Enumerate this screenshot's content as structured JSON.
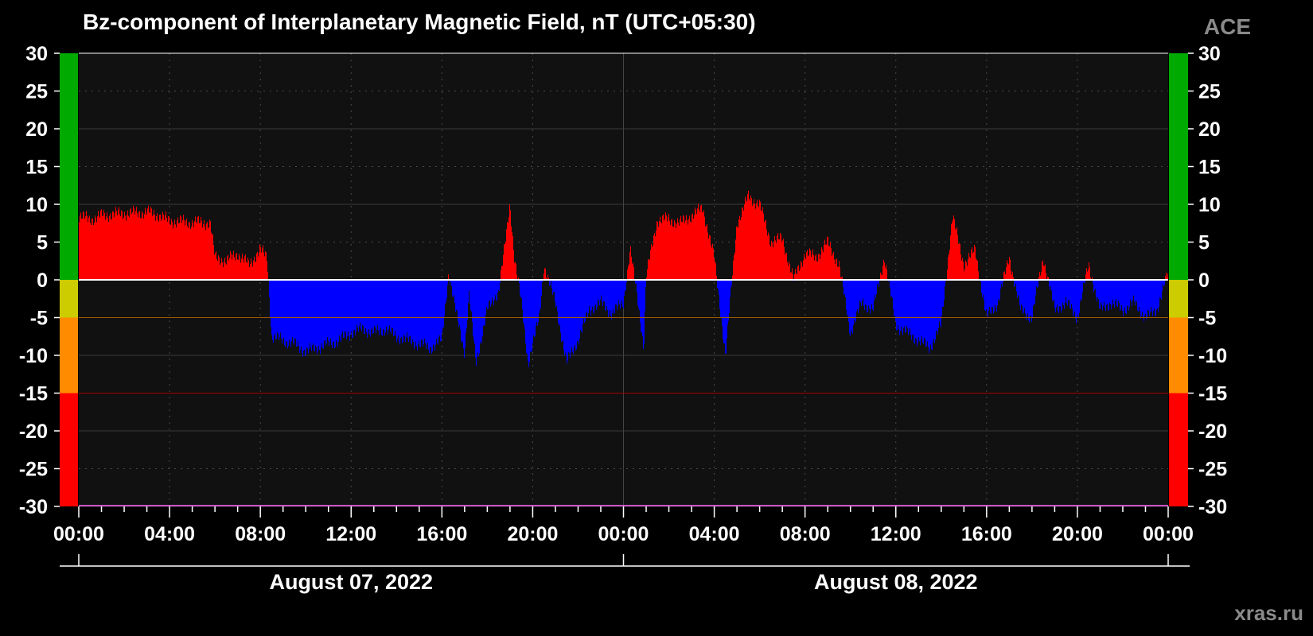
{
  "header": {
    "title": "Bz-component of Interplanetary Magnetic Field, nT (UTC+05:30)",
    "source": "ACE",
    "credit": "xras.ru"
  },
  "colors": {
    "background": "#000000",
    "plot_background": "#111111",
    "positive": "#ff0000",
    "negative": "#0000ff",
    "scale_green": "#00aa00",
    "scale_yellow": "#cccc00",
    "scale_orange": "#ff8c00",
    "scale_red": "#ff0000"
  },
  "chart_data": {
    "type": "bar",
    "title": "Bz-component of Interplanetary Magnetic Field, nT (UTC+05:30)",
    "ylim": [
      -30,
      30
    ],
    "yticks": [
      30,
      25,
      20,
      15,
      10,
      5,
      0,
      -5,
      -10,
      -15,
      -20,
      -25,
      -30
    ],
    "xlim_hours": [
      0,
      48
    ],
    "xtick_labels": [
      "00:00",
      "04:00",
      "08:00",
      "12:00",
      "16:00",
      "20:00",
      "00:00",
      "04:00",
      "08:00",
      "12:00",
      "16:00",
      "20:00",
      "00:00"
    ],
    "date_labels": [
      "August 07, 2022",
      "August 08, 2022"
    ],
    "reference_lines": [
      0,
      -5,
      -15
    ],
    "severity_scale": [
      {
        "from": 0,
        "to": 30,
        "color": "#00aa00"
      },
      {
        "from": -5,
        "to": 0,
        "color": "#cccc00"
      },
      {
        "from": -15,
        "to": -5,
        "color": "#ff8c00"
      },
      {
        "from": -30,
        "to": -15,
        "color": "#ff0000"
      }
    ],
    "x_hours": [
      0,
      0.5,
      1,
      1.5,
      2,
      2.5,
      3,
      3.5,
      4,
      4.5,
      5,
      5.5,
      5.8,
      6,
      6.5,
      7,
      7.5,
      8,
      8.3,
      8.5,
      9,
      9.5,
      10,
      10.5,
      11,
      11.5,
      12,
      12.5,
      13,
      13.5,
      14,
      14.5,
      15,
      15.5,
      16,
      16.3,
      16.6,
      17,
      17.2,
      17.5,
      17.8,
      18,
      18.5,
      18.8,
      19,
      19.2,
      19.5,
      19.8,
      20,
      20.3,
      20.5,
      21,
      21.5,
      22,
      22.5,
      23,
      23.5,
      24,
      24.3,
      24.6,
      24.9,
      25,
      25.5,
      26,
      26.5,
      27,
      27.5,
      28,
      28.5,
      29,
      29.5,
      30,
      30.5,
      31,
      31.5,
      32,
      32.5,
      33,
      33.5,
      34,
      34.5,
      35,
      35.5,
      36,
      36.5,
      37,
      37.5,
      38,
      38.5,
      39,
      39.5,
      40,
      40.5,
      41,
      41.5,
      42,
      42.5,
      43,
      43.5,
      44,
      44.5,
      45,
      45.5,
      46,
      46.5,
      47,
      47.5,
      48
    ],
    "bz_nT": [
      8.5,
      8,
      8.5,
      8.7,
      8.8,
      8.9,
      9,
      8.6,
      7.8,
      7.7,
      7.6,
      7.6,
      7.5,
      3,
      2.5,
      3.5,
      2,
      4,
      3,
      -7.5,
      -8,
      -8.5,
      -9.5,
      -9,
      -8.5,
      -8,
      -7,
      -6.5,
      -7,
      -6.5,
      -7.5,
      -8,
      -8.5,
      -9,
      -8,
      1,
      -4,
      -9.5,
      -2,
      -11,
      -7,
      -4,
      -1.5,
      5,
      10,
      3,
      -3,
      -11,
      -8.5,
      -5,
      2,
      -3,
      -11,
      -8,
      -4,
      -3,
      -4.5,
      -3,
      4,
      -2,
      -9,
      0.5,
      8,
      8,
      7.5,
      8.5,
      9.5,
      3,
      -10,
      7.5,
      11,
      10,
      5,
      5.5,
      0,
      3.5,
      3,
      5,
      2,
      -7,
      -3,
      -4,
      3,
      -6,
      -7,
      -8,
      -9,
      -6,
      8.5,
      2,
      4,
      -5,
      -3,
      3,
      -4,
      -5,
      3,
      -4,
      -3,
      -5,
      2,
      -4,
      -3,
      -4,
      -3,
      -5,
      -4,
      1,
      -4
    ]
  }
}
